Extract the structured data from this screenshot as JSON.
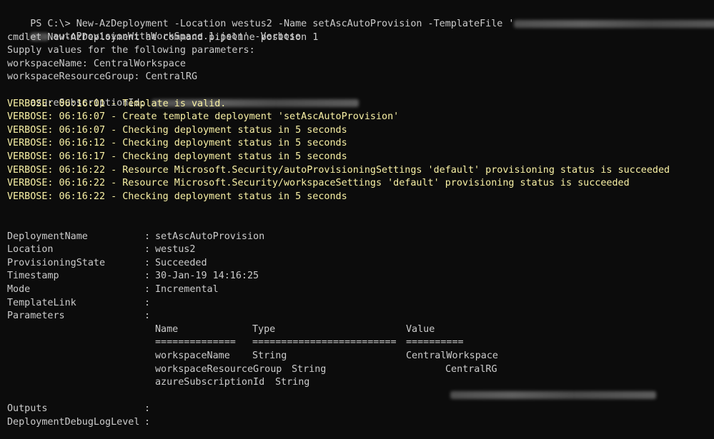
{
  "prompt": {
    "line1_before": "PS C:\\> New-AzDeployment -Location westus2 -Name setAscAutoProvision -TemplateFile '",
    "line2_after": "autoProvisionWithWorkSpace.1.json' -Verbose"
  },
  "messages": {
    "cmdlet": "cmdlet New-AzDeployment at command pipeline position 1",
    "supply": "Supply values for the following parameters:",
    "workspaceName": "workspaceName: CentralWorkspace",
    "workspaceResourceGroup": "workspaceResourceGroup: CentralRG",
    "azureSubscriptionId": "azureSubscriptionId: "
  },
  "verbose": [
    "VERBOSE: 06:16:01 - Template is valid.",
    "VERBOSE: 06:16:07 - Create template deployment 'setAscAutoProvision'",
    "VERBOSE: 06:16:07 - Checking deployment status in 5 seconds",
    "VERBOSE: 06:16:12 - Checking deployment status in 5 seconds",
    "VERBOSE: 06:16:17 - Checking deployment status in 5 seconds",
    "VERBOSE: 06:16:22 - Resource Microsoft.Security/autoProvisioningSettings 'default' provisioning status is succeeded",
    "VERBOSE: 06:16:22 - Resource Microsoft.Security/workspaceSettings 'default' provisioning status is succeeded",
    "VERBOSE: 06:16:22 - Checking deployment status in 5 seconds"
  ],
  "result": {
    "DeploymentName": {
      "key": "DeploymentName",
      "value": "setAscAutoProvision"
    },
    "Location": {
      "key": "Location",
      "value": "westus2"
    },
    "ProvisioningState": {
      "key": "ProvisioningState",
      "value": "Succeeded"
    },
    "Timestamp": {
      "key": "Timestamp",
      "value": "30-Jan-19 14:16:25"
    },
    "Mode": {
      "key": "Mode",
      "value": "Incremental"
    },
    "TemplateLink": {
      "key": "TemplateLink",
      "value": ""
    },
    "Parameters": {
      "key": "Parameters",
      "value": ""
    },
    "Outputs": {
      "key": "Outputs",
      "value": ""
    },
    "DeploymentDebugLogLevel": {
      "key": "DeploymentDebugLogLevel",
      "value": ""
    },
    "separator": ":"
  },
  "params_table": {
    "headers": {
      "name": "Name",
      "type": "Type",
      "value": "Value"
    },
    "underlines": {
      "name": "==============",
      "type": "=========================",
      "value": "=========="
    },
    "rows": [
      {
        "name": "workspaceName",
        "type": "String",
        "value": "CentralWorkspace"
      },
      {
        "name": "workspaceResourceGroup",
        "type": "String",
        "value": "CentralRG"
      },
      {
        "name": "azureSubscriptionId",
        "type": "String",
        "value": ""
      }
    ]
  },
  "colors": {
    "background": "#0c0c0c",
    "foreground": "#cccccc",
    "verbose": "#f9f1a5"
  }
}
